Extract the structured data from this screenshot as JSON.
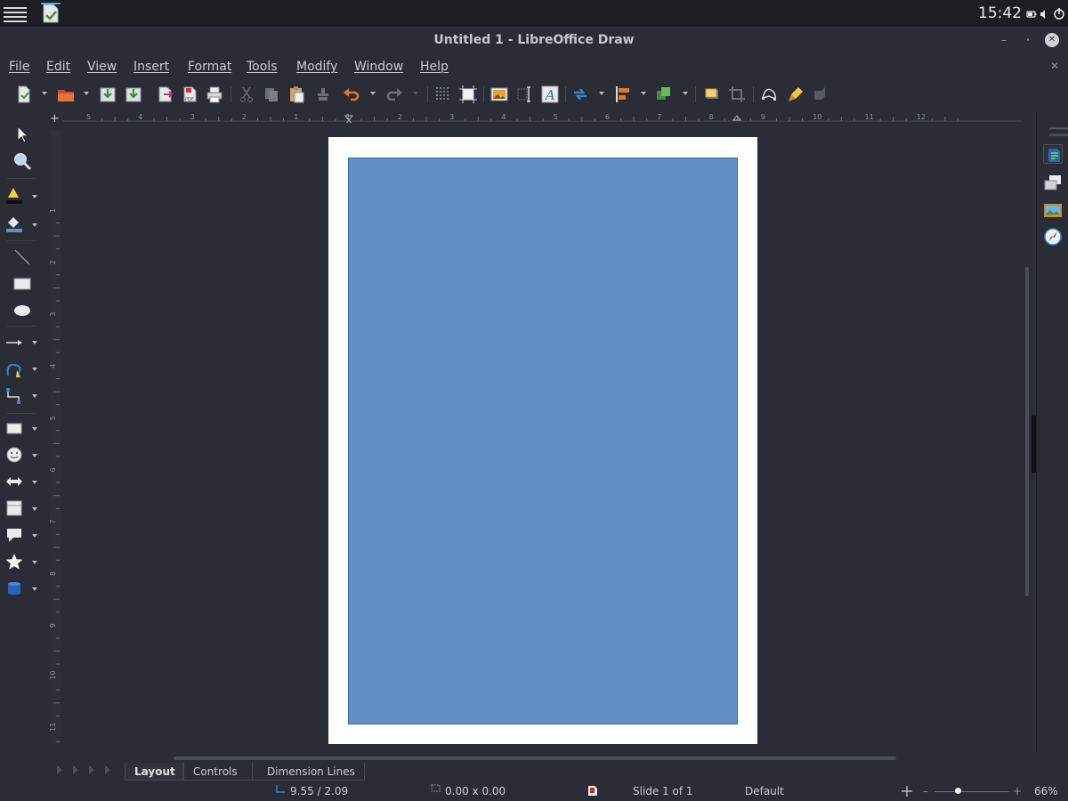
{
  "panel": {
    "clock": "15:42"
  },
  "window": {
    "title": "Untitled 1 - LibreOffice Draw",
    "minimize": "–",
    "restore": "⬝",
    "close": "✕"
  },
  "menu": [
    "File",
    "Edit",
    "View",
    "Insert",
    "Format",
    "Tools",
    "Modify",
    "Window",
    "Help"
  ],
  "document": {
    "close": "✕"
  },
  "rulers": {
    "horizontal_ticks": [
      "5",
      "4",
      "3",
      "2",
      "1",
      "1",
      "2",
      "3",
      "4",
      "5",
      "6",
      "7",
      "8",
      "9",
      "10",
      "11",
      "12"
    ],
    "vertical_ticks": [
      "1",
      "2",
      "3",
      "4",
      "5",
      "6",
      "7",
      "8",
      "9",
      "10",
      "11"
    ],
    "corner": "+"
  },
  "tabs": [
    {
      "label": "Layout",
      "active": true
    },
    {
      "label": "Controls",
      "active": false
    },
    {
      "label": "Dimension Lines",
      "active": false
    }
  ],
  "status": {
    "position": "9.55 / 2.09",
    "size": "0.00 x 0.00",
    "slide": "Slide 1 of 1",
    "master": "Default",
    "zoom": "66%",
    "zoom_minus": "–",
    "zoom_plus": "+"
  },
  "shape": {
    "fill_color": "#6190c6",
    "border_color": "#3d6699"
  },
  "colors": {
    "background": "#2a2d36",
    "panel": "#1c1e24",
    "page": "#ffffff",
    "accent": "#3daee9"
  }
}
